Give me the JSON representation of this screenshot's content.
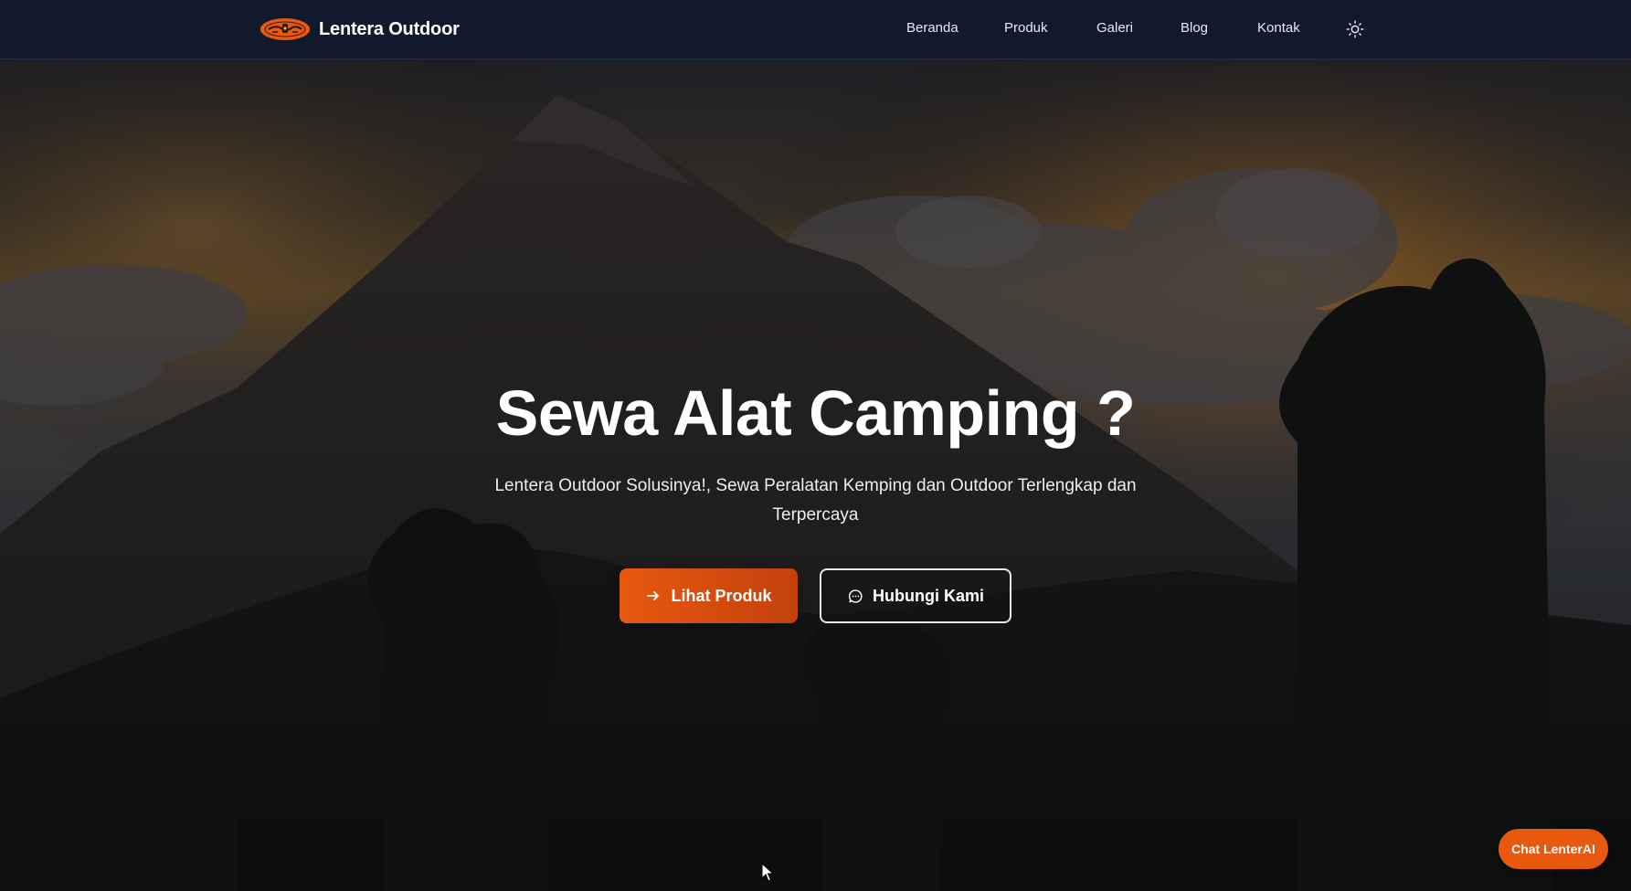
{
  "brand": {
    "name": "Lentera Outdoor",
    "logo_icon": "lantern-logo-icon",
    "accent_color": "#e8580f"
  },
  "nav": {
    "items": [
      {
        "label": "Beranda"
      },
      {
        "label": "Produk"
      },
      {
        "label": "Galeri"
      },
      {
        "label": "Blog"
      },
      {
        "label": "Kontak"
      }
    ],
    "theme_toggle_icon": "sun-icon"
  },
  "hero": {
    "title": "Sewa Alat Camping ?",
    "subtitle": "Lentera Outdoor Solusinya!, Sewa Peralatan Kemping dan Outdoor Terlengkap dan Terpercaya",
    "background": "mountain-sunset-image",
    "primary_button": {
      "label": "Lihat Produk",
      "icon": "arrow-right-icon"
    },
    "secondary_button": {
      "label": "Hubungi Kami",
      "icon": "chat-bubble-icon"
    }
  },
  "chat_widget": {
    "label": "Chat LenterAI"
  },
  "colors": {
    "navbar_bg": "#111a2d",
    "primary": "#e8580f",
    "primary_dark": "#c2410c"
  }
}
